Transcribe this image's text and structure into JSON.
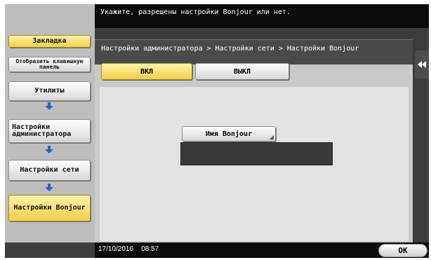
{
  "message": "Укажите, разрешены настройки Bonjour или нет.",
  "sidebar": {
    "bookmark_label": "Закладка",
    "show_keypad_label": "Отобразить клавишную панель",
    "path": [
      {
        "label": "Утилиты"
      },
      {
        "label": "Настройки администратора"
      },
      {
        "label": "Настройки сети"
      },
      {
        "label": "Настройки Bonjour"
      }
    ]
  },
  "breadcrumb": "Настройки администратора > Настройки сети > Настройки Bonjour",
  "toggle": {
    "on_label": "ВКЛ",
    "off_label": "ВЫКЛ",
    "selected": "on"
  },
  "bonjour_name": {
    "button_label": "Имя Bonjour",
    "value": ""
  },
  "footer": {
    "date": "17/10/2016",
    "time": "08:57",
    "ok_label": "OK"
  },
  "colors": {
    "selected": "#f1cf4a",
    "panel_dark": "#3c3c3c",
    "bar_black": "#0b0b0b"
  },
  "icons": [
    "down-arrow-icon",
    "collapse-double-arrow-icon",
    "corner-mark-icon"
  ]
}
